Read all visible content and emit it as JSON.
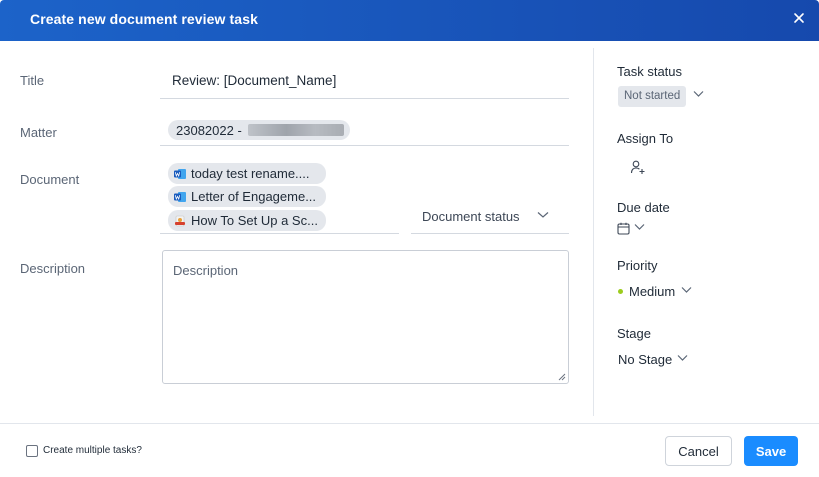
{
  "dialog": {
    "title": "Create new document review task",
    "close_icon": "close-icon"
  },
  "form": {
    "title_label": "Title",
    "title_value": "Review: [Document_Name]",
    "matter_label": "Matter",
    "matter_value": "23082022 -",
    "document_label": "Document",
    "documents": [
      {
        "name": "today test rename....",
        "icon": "word-icon"
      },
      {
        "name": "Letter of Engageme...",
        "icon": "word-icon"
      },
      {
        "name": "How To Set Up a Sc...",
        "icon": "pdf-icon"
      }
    ],
    "document_status_placeholder": "Document status",
    "description_label": "Description",
    "description_placeholder": "Description"
  },
  "sidebar": {
    "task_status_label": "Task status",
    "task_status_value": "Not started",
    "assign_to_label": "Assign To",
    "due_date_label": "Due date",
    "priority_label": "Priority",
    "priority_value": "Medium",
    "stage_label": "Stage",
    "stage_value": "No Stage"
  },
  "footer": {
    "multiple_tasks_label": "Create multiple tasks?",
    "multiple_tasks_checked": false,
    "cancel_label": "Cancel",
    "save_label": "Save"
  },
  "colors": {
    "header": "#1c63c9",
    "primary_button": "#1a8cff",
    "priority_medium": "#9ccc1d"
  }
}
